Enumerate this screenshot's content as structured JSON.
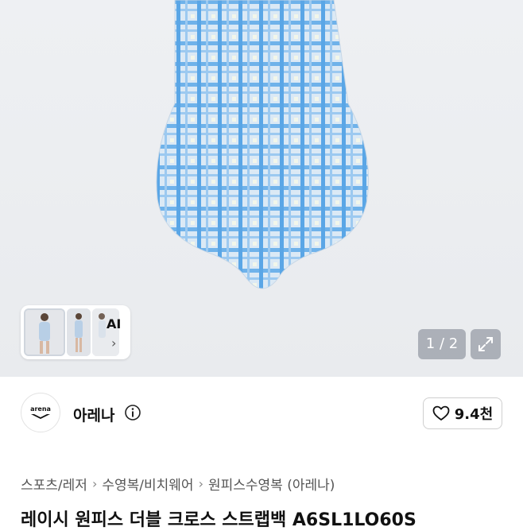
{
  "gallery": {
    "ai_label": "AI",
    "page_indicator": "1 / 2",
    "current_page": 1,
    "total_pages": 2
  },
  "seller": {
    "brand_name": "아레나",
    "logo_text": "arena",
    "like_count": "9.4천"
  },
  "breadcrumb": [
    "스포츠/레저",
    "수영복/비치웨어",
    "원피스수영복 (아레나)"
  ],
  "product": {
    "title": "레이시 원피스 더블 크로스 스트랩백 A6SL1LO60S"
  },
  "colors": {
    "swimsuit_blue": "#5aa6e6",
    "swimsuit_base": "#d8e8f4",
    "overlay": "#7a828d"
  },
  "icons": {
    "info": "info-icon",
    "heart": "heart-icon",
    "expand": "expand-icon",
    "chevron": "chevron-right-icon"
  }
}
